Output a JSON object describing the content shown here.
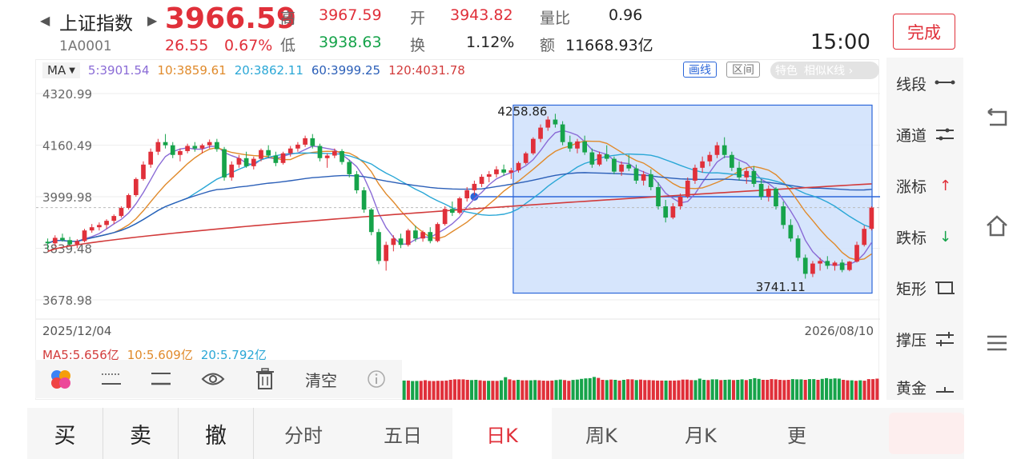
{
  "header": {
    "index_name": "上证指数",
    "index_code": "1A0001",
    "price": "3966.59",
    "change": "26.55",
    "change_pct": "0.67%",
    "high_label": "高",
    "high_value": "3967.59",
    "low_label": "低",
    "low_value": "3938.63",
    "open_label": "开",
    "open_value": "3943.82",
    "turnover_label": "换",
    "turnover_value": "1.12%",
    "volratio_label": "量比",
    "volratio_value": "0.96",
    "amount_label": "额",
    "amount_value": "11668.93亿",
    "time": "15:00",
    "done_label": "完成"
  },
  "ma": {
    "selector": "MA",
    "items": [
      {
        "text": "5:3901.54",
        "color": "#8a6bd6"
      },
      {
        "text": "10:3859.61",
        "color": "#e08a2b"
      },
      {
        "text": "20:3862.11",
        "color": "#2aa7d6"
      },
      {
        "text": "60:3999.25",
        "color": "#2b5fb8"
      },
      {
        "text": "120:4031.78",
        "color": "#d23b3b"
      }
    ]
  },
  "chart_tags": {
    "line_label": "画线",
    "range_label": "区间",
    "feature_label": "特色",
    "similar_label": "相似K线 ›"
  },
  "chart_data": {
    "type": "candlestick",
    "y_ticks": [
      "4320.99",
      "4160.49",
      "3999.98",
      "3839.48",
      "3678.98"
    ],
    "ylim": [
      3678.98,
      4320.99
    ],
    "x_start": "2025/12/04",
    "x_end": "2026/08/10",
    "high_annotation": "4258.86",
    "low_annotation": "3741.11",
    "candles": [
      [
        3860,
        3870,
        3835,
        3855
      ],
      [
        3855,
        3880,
        3845,
        3872
      ],
      [
        3872,
        3885,
        3860,
        3865
      ],
      [
        3865,
        3875,
        3848,
        3852
      ],
      [
        3852,
        3868,
        3840,
        3862
      ],
      [
        3862,
        3900,
        3858,
        3895
      ],
      [
        3895,
        3915,
        3888,
        3905
      ],
      [
        3905,
        3920,
        3895,
        3912
      ],
      [
        3912,
        3930,
        3900,
        3925
      ],
      [
        3925,
        3945,
        3915,
        3940
      ],
      [
        3940,
        3970,
        3935,
        3965
      ],
      [
        3965,
        4010,
        3960,
        4005
      ],
      [
        4005,
        4060,
        4000,
        4055
      ],
      [
        4055,
        4110,
        4050,
        4100
      ],
      [
        4100,
        4150,
        4090,
        4140
      ],
      [
        4140,
        4180,
        4130,
        4170
      ],
      [
        4170,
        4195,
        4150,
        4160
      ],
      [
        4160,
        4170,
        4120,
        4130
      ],
      [
        4130,
        4150,
        4110,
        4142
      ],
      [
        4142,
        4165,
        4135,
        4158
      ],
      [
        4158,
        4170,
        4140,
        4150
      ],
      [
        4150,
        4165,
        4135,
        4160
      ],
      [
        4160,
        4178,
        4150,
        4170
      ],
      [
        4170,
        4180,
        4140,
        4148
      ],
      [
        4148,
        4155,
        4050,
        4060
      ],
      [
        4060,
        4110,
        4050,
        4100
      ],
      [
        4100,
        4130,
        4090,
        4120
      ],
      [
        4120,
        4140,
        4090,
        4095
      ],
      [
        4095,
        4125,
        4085,
        4118
      ],
      [
        4118,
        4150,
        4110,
        4145
      ],
      [
        4145,
        4160,
        4120,
        4128
      ],
      [
        4128,
        4140,
        4095,
        4105
      ],
      [
        4105,
        4140,
        4100,
        4135
      ],
      [
        4135,
        4158,
        4125,
        4150
      ],
      [
        4150,
        4170,
        4140,
        4162
      ],
      [
        4162,
        4190,
        4155,
        4182
      ],
      [
        4182,
        4195,
        4150,
        4158
      ],
      [
        4158,
        4165,
        4110,
        4120
      ],
      [
        4120,
        4135,
        4090,
        4128
      ],
      [
        4128,
        4150,
        4120,
        4142
      ],
      [
        4142,
        4148,
        4100,
        4108
      ],
      [
        4108,
        4115,
        4060,
        4070
      ],
      [
        4070,
        4080,
        4010,
        4020
      ],
      [
        4020,
        4030,
        3950,
        3960
      ],
      [
        3960,
        3965,
        3880,
        3890
      ],
      [
        3890,
        3900,
        3790,
        3800
      ],
      [
        3800,
        3860,
        3770,
        3850
      ],
      [
        3850,
        3880,
        3830,
        3870
      ],
      [
        3870,
        3885,
        3840,
        3850
      ],
      [
        3850,
        3900,
        3845,
        3895
      ],
      [
        3895,
        3910,
        3860,
        3870
      ],
      [
        3870,
        3895,
        3860,
        3890
      ],
      [
        3890,
        3905,
        3855,
        3862
      ],
      [
        3862,
        3920,
        3858,
        3915
      ],
      [
        3915,
        3970,
        3910,
        3962
      ],
      [
        3962,
        3985,
        3940,
        3950
      ],
      [
        3950,
        4000,
        3945,
        3995
      ],
      [
        3995,
        4030,
        3985,
        4020
      ],
      [
        4020,
        4050,
        4005,
        4040
      ],
      [
        4040,
        4070,
        4030,
        4062
      ],
      [
        4062,
        4080,
        4045,
        4070
      ],
      [
        4070,
        4095,
        4060,
        4085
      ],
      [
        4085,
        4100,
        4065,
        4075
      ],
      [
        4075,
        4090,
        4055,
        4082
      ],
      [
        4082,
        4110,
        4075,
        4105
      ],
      [
        4105,
        4140,
        4100,
        4135
      ],
      [
        4135,
        4185,
        4130,
        4180
      ],
      [
        4180,
        4225,
        4170,
        4215
      ],
      [
        4215,
        4250,
        4205,
        4240
      ],
      [
        4240,
        4258,
        4215,
        4225
      ],
      [
        4225,
        4235,
        4160,
        4170
      ],
      [
        4170,
        4190,
        4140,
        4150
      ],
      [
        4150,
        4180,
        4135,
        4172
      ],
      [
        4172,
        4190,
        4130,
        4138
      ],
      [
        4138,
        4150,
        4090,
        4100
      ],
      [
        4100,
        4140,
        4095,
        4132
      ],
      [
        4132,
        4160,
        4110,
        4118
      ],
      [
        4118,
        4125,
        4070,
        4078
      ],
      [
        4078,
        4110,
        4065,
        4100
      ],
      [
        4100,
        4130,
        4080,
        4088
      ],
      [
        4088,
        4100,
        4040,
        4050
      ],
      [
        4050,
        4080,
        4035,
        4070
      ],
      [
        4070,
        4085,
        4020,
        4030
      ],
      [
        4030,
        4045,
        3960,
        3970
      ],
      [
        3970,
        3990,
        3920,
        3935
      ],
      [
        3935,
        3980,
        3930,
        3970
      ],
      [
        3970,
        4010,
        3960,
        4000
      ],
      [
        4000,
        4060,
        3995,
        4050
      ],
      [
        4050,
        4100,
        4040,
        4090
      ],
      [
        4090,
        4125,
        4075,
        4110
      ],
      [
        4110,
        4140,
        4095,
        4130
      ],
      [
        4130,
        4170,
        4120,
        4160
      ],
      [
        4160,
        4185,
        4120,
        4130
      ],
      [
        4130,
        4140,
        4080,
        4090
      ],
      [
        4090,
        4110,
        4050,
        4060
      ],
      [
        4060,
        4090,
        4040,
        4080
      ],
      [
        4080,
        4095,
        4030,
        4040
      ],
      [
        4040,
        4055,
        3990,
        4000
      ],
      [
        4000,
        4035,
        3985,
        4025
      ],
      [
        4025,
        4030,
        3960,
        3970
      ],
      [
        3970,
        3985,
        3900,
        3912
      ],
      [
        3912,
        3930,
        3860,
        3870
      ],
      [
        3870,
        3880,
        3800,
        3810
      ],
      [
        3810,
        3820,
        3745,
        3760
      ],
      [
        3760,
        3800,
        3750,
        3792
      ],
      [
        3792,
        3810,
        3770,
        3800
      ],
      [
        3800,
        3815,
        3775,
        3785
      ],
      [
        3785,
        3800,
        3770,
        3795
      ],
      [
        3795,
        3805,
        3765,
        3772
      ],
      [
        3772,
        3800,
        3768,
        3798
      ],
      [
        3798,
        3860,
        3795,
        3850
      ],
      [
        3850,
        3910,
        3845,
        3900
      ],
      [
        3900,
        3970,
        3895,
        3966
      ]
    ]
  },
  "volume": {
    "ma5": "MA5:5.656亿",
    "ma10": "10:5.609亿",
    "ma20": "20:5.792亿"
  },
  "draw_toolbar": {
    "clear_label": "清空"
  },
  "right_tools": [
    {
      "label": "线段",
      "icon": "segment-icon"
    },
    {
      "label": "通道",
      "icon": "channel-icon"
    },
    {
      "label": "涨标",
      "icon": "up-arrow-icon"
    },
    {
      "label": "跌标",
      "icon": "down-arrow-icon"
    },
    {
      "label": "矩形",
      "icon": "rectangle-icon"
    },
    {
      "label": "撑压",
      "icon": "support-icon"
    },
    {
      "label": "黄金",
      "icon": "golden-icon"
    }
  ],
  "tabs": [
    {
      "label": "买"
    },
    {
      "label": "卖"
    },
    {
      "label": "撤"
    },
    {
      "label": "分时"
    },
    {
      "label": "五日"
    },
    {
      "label": "日K"
    },
    {
      "label": "周K"
    },
    {
      "label": "月K"
    },
    {
      "label": "更"
    }
  ],
  "colors": {
    "up": "#e0303a",
    "down": "#16a34a",
    "accent": "#2b66d9"
  }
}
